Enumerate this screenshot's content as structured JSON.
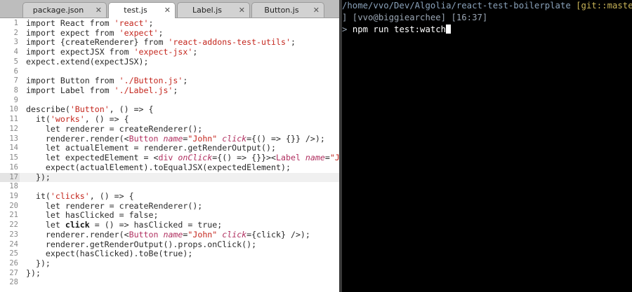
{
  "tabs": [
    {
      "label": "package.json",
      "close": "✕"
    },
    {
      "label": "test.js",
      "close": "✕"
    },
    {
      "label": "Label.js",
      "close": "✕"
    },
    {
      "label": "Button.js",
      "close": "✕"
    }
  ],
  "editor": {
    "line_numbers": [
      "1",
      "2",
      "3",
      "4",
      "5",
      "6",
      "7",
      "8",
      "9",
      "10",
      "11",
      "12",
      "13",
      "14",
      "15",
      "16",
      "17",
      "18",
      "19",
      "20",
      "21",
      "22",
      "23",
      "24",
      "25",
      "26",
      "27",
      "28"
    ],
    "current_line": "17"
  },
  "terminal": {
    "path": "/home/vvo/Dev/Algolia/react-test-boilerplate",
    "git": "[git::master *",
    "status": "] [vvo@biggiearchee] [16:37]",
    "prompt": ">",
    "command": "npm run test:watch"
  },
  "code": {
    "l1": {
      "p1": "import React from ",
      "p2": "'react'",
      "p3": ";"
    },
    "l2": {
      "p1": "import expect from ",
      "p2": "'expect'",
      "p3": ";"
    },
    "l3": {
      "p1": "import {createRenderer} from ",
      "p2": "'react-addons-test-utils'",
      "p3": ";"
    },
    "l4": {
      "p1": "import expectJSX from ",
      "p2": "'expect-jsx'",
      "p3": ";"
    },
    "l5": {
      "p1": "expect.extend(expectJSX);"
    },
    "l7": {
      "p1": "import Button from ",
      "p2": "'./Button.js'",
      "p3": ";"
    },
    "l8": {
      "p1": "import Label from ",
      "p2": "'./Label.js'",
      "p3": ";"
    },
    "l10": {
      "p1": "describe(",
      "p2": "'Button'",
      "p3": ", () => {"
    },
    "l11": {
      "p1": "  it(",
      "p2": "'works'",
      "p3": ", () => {"
    },
    "l12": {
      "p1": "    let renderer = createRenderer();"
    },
    "l13": {
      "p1": "    renderer.render(<",
      "p2": "Button",
      "p3": " ",
      "p4": "name",
      "p5": "=",
      "p6": "\"John\"",
      "p7": " ",
      "p8": "click",
      "p9": "={() => {}} />);"
    },
    "l14": {
      "p1": "    let actualElement = renderer.getRenderOutput();"
    },
    "l15": {
      "p1": "    let expectedElement = <",
      "p2": "div",
      "p3": " ",
      "p4": "onClick",
      "p5": "={() => {}}><",
      "p6": "Label",
      "p7": " ",
      "p8": "name",
      "p9": "=",
      "p10": "\"John\""
    },
    "l16": {
      "p1": "    expect(actualElement).toEqualJSX(expectedElement);"
    },
    "l17": {
      "p1": "  });"
    },
    "l19": {
      "p1": "  it(",
      "p2": "'clicks'",
      "p3": ", () => {"
    },
    "l20": {
      "p1": "    let renderer = createRenderer();"
    },
    "l21": {
      "p1": "    let hasClicked = false;"
    },
    "l22": {
      "p1": "    let ",
      "p2": "click",
      "p3": " = () => hasClicked = true;"
    },
    "l23": {
      "p1": "    renderer.render(<",
      "p2": "Button",
      "p3": " ",
      "p4": "name",
      "p5": "=",
      "p6": "\"John\"",
      "p7": " ",
      "p8": "click",
      "p9": "={click} />);"
    },
    "l24": {
      "p1": "    renderer.getRenderOutput().props.onClick();"
    },
    "l25": {
      "p1": "    expect(hasClicked).toBe(true);"
    },
    "l26": {
      "p1": "  });"
    },
    "l27": {
      "p1": "});"
    }
  }
}
